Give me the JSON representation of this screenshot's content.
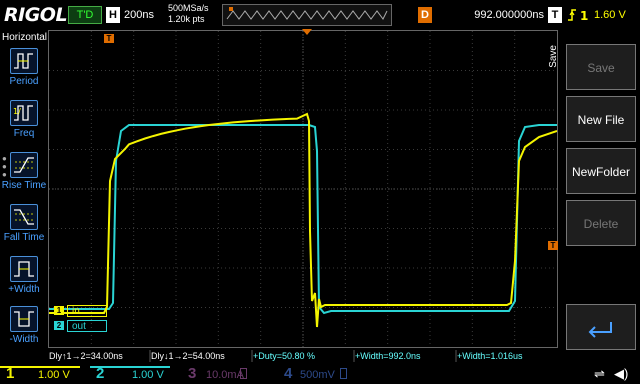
{
  "header": {
    "brand": "RIGOL",
    "trigger_status": "T'D",
    "horizontal_badge": "H",
    "timebase": "200ns",
    "sample_rate": "500MSa/s",
    "memory_depth": "1.20k pts",
    "delay_badge": "D",
    "delay": "992.000000ns",
    "trigger_badge": "T",
    "trigger_level": "1.60 V"
  },
  "left_menu": {
    "title": "Horizontal",
    "items": [
      {
        "label": "Period",
        "icon": "period-icon"
      },
      {
        "label": "Freq",
        "icon": "frequency-icon"
      },
      {
        "label": "Rise Time",
        "icon": "rise-time-icon"
      },
      {
        "label": "Fall Time",
        "icon": "fall-time-icon"
      },
      {
        "label": "+Width",
        "icon": "positive-width-icon"
      },
      {
        "label": "-Width",
        "icon": "negative-width-icon"
      }
    ]
  },
  "right_menu": {
    "title": "Save",
    "buttons": [
      {
        "label": "Save",
        "enabled": false
      },
      {
        "label": "New File",
        "enabled": true
      },
      {
        "label": "NewFolder",
        "enabled": true
      },
      {
        "label": "Delete",
        "enabled": false
      },
      {
        "label": "",
        "icon": "enter-arrow-icon",
        "enabled": true
      }
    ]
  },
  "waveform_labels": {
    "ch1_marker": "1",
    "ch1_label": "in",
    "ch2_marker": "2",
    "ch2_label": "out",
    "trigger_marker": "T",
    "trigger_position_marker": "T"
  },
  "measurements": [
    {
      "text": "Dly↑1→2=34.00ns",
      "color": "white"
    },
    {
      "text": "Dly↓1→2=54.00ns",
      "color": "white"
    },
    {
      "text": "+Duty=50.80 %",
      "color": "cyan"
    },
    {
      "text": "+Width=992.0ns",
      "color": "cyan"
    },
    {
      "text": "+Width=1.016us",
      "color": "cyan"
    }
  ],
  "channels": [
    {
      "num": "1",
      "value": "1.00 V",
      "color": "#f4f400",
      "active": true
    },
    {
      "num": "2",
      "value": "1.00 V",
      "color": "#2ad4d4",
      "active": true
    },
    {
      "num": "3",
      "value": "10.0mA",
      "color": "#b04ab0",
      "active": false
    },
    {
      "num": "4",
      "value": "500mV",
      "color": "#3a6cd8",
      "active": false
    }
  ],
  "colors": {
    "ch1": "#f4f400",
    "ch2": "#2ad4d4",
    "trigger": "#e06d00",
    "menu_accent": "#4aa0ff"
  }
}
